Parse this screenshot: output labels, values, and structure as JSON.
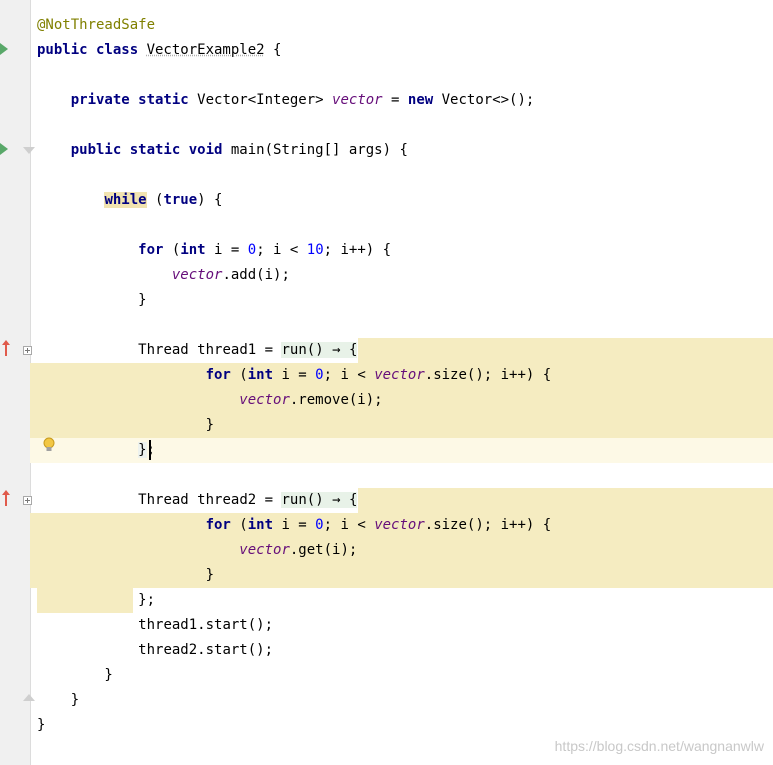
{
  "colors": {
    "keyword": "#000080",
    "number": "#0000ff",
    "annotation": "#808000",
    "field": "#660e7a",
    "block_highlight": "#f5ecc1",
    "caret_line": "#fdf9e6",
    "run_marker": "#59a869",
    "override_marker": "#e05a4b",
    "watermark": "#c8c8c8"
  },
  "icons": {
    "run": "run-gutter-icon",
    "fold": "fold-icon",
    "override": "override-arrow-icon",
    "intention": "lightbulb-icon"
  },
  "code": {
    "annotation": "@NotThreadSafe",
    "class_name": "VectorExample2",
    "vector_type": "Vector<Integer>",
    "vector_field": "vector",
    "vector_ctor": "Vector<>();",
    "main_name": "main",
    "main_params": "(String[] args) {",
    "loop_limit": "10",
    "zero": "0",
    "add_call": ".add(i);",
    "thread_type": "Thread",
    "thread1": "thread1",
    "thread2": "thread2",
    "run_call": "run()",
    "arrow": "→",
    "size_call": ".size();",
    "remove_call": ".remove(i);",
    "get_call": ".get(i);",
    "start1": "thread1.start();",
    "start2": "thread2.start();"
  },
  "watermark": "https://blog.csdn.net/wangnanwlw"
}
